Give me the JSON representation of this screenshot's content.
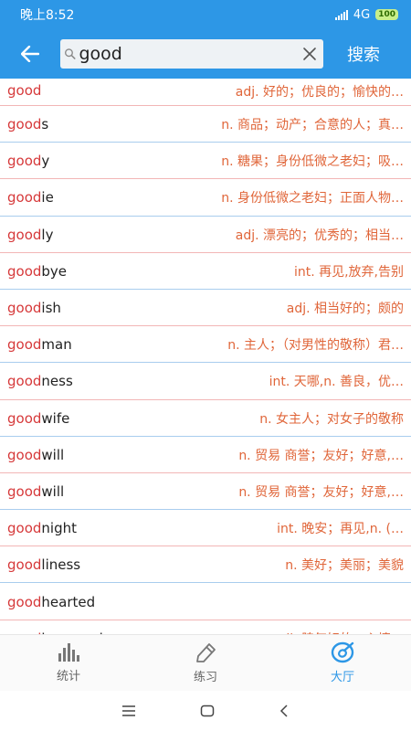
{
  "status_bar": {
    "time": "晚上8:52",
    "network": "4G",
    "battery": "100"
  },
  "search": {
    "query": "good",
    "submit_label": "搜索"
  },
  "colors": {
    "primary": "#2d97e6",
    "highlight": "#d6393a",
    "definition": "#e0663a"
  },
  "results": [
    {
      "prefix": "good",
      "rest": "",
      "definition": "adj. 好的；优良的；愉快的…",
      "line": "red"
    },
    {
      "prefix": "good",
      "rest": "s",
      "definition": "n. 商品；动产；合意的人；真…",
      "line": "blue"
    },
    {
      "prefix": "good",
      "rest": "y",
      "definition": "n. 糖果；身份低微之老妇；吸…",
      "line": "red"
    },
    {
      "prefix": "good",
      "rest": "ie",
      "definition": "n. 身份低微之老妇；正面人物…",
      "line": "blue"
    },
    {
      "prefix": "good",
      "rest": "ly",
      "definition": "adj. 漂亮的；优秀的；相当…",
      "line": "red"
    },
    {
      "prefix": "good",
      "rest": "bye",
      "definition": "int. 再见,放弃,告别",
      "line": "blue"
    },
    {
      "prefix": "good",
      "rest": "ish",
      "definition": "adj. 相当好的；颇的",
      "line": "red"
    },
    {
      "prefix": "good",
      "rest": "man",
      "definition": "n. 主人；（对男性的敬称）君…",
      "line": "blue"
    },
    {
      "prefix": "good",
      "rest": "ness",
      "definition": "int. 天哪,n. 善良，优…",
      "line": "red"
    },
    {
      "prefix": "good",
      "rest": "wife",
      "definition": "n. 女主人；对女子的敬称",
      "line": "blue"
    },
    {
      "prefix": "good",
      "rest": "will",
      "definition": "n. 贸易 商誉；友好；好意,…",
      "line": "red"
    },
    {
      "prefix": "good",
      "rest": "will",
      "definition": "n. 贸易 商誉；友好；好意,…",
      "line": "blue"
    },
    {
      "prefix": "good",
      "rest": "night",
      "definition": "int. 晚安；再见,n. (…",
      "line": "red"
    },
    {
      "prefix": "good",
      "rest": "liness",
      "definition": "n. 美好；美丽；美貌",
      "line": "blue"
    },
    {
      "prefix": "good",
      "rest": "hearted",
      "definition": "",
      "line": "red"
    },
    {
      "prefix": "good",
      "rest": "humored",
      "definition": "adj. 脾气好的；心情…",
      "line": "blue"
    }
  ],
  "bottom_nav": [
    {
      "label": "统计",
      "icon": "bar-chart-icon",
      "active": false
    },
    {
      "label": "练习",
      "icon": "pencil-icon",
      "active": false
    },
    {
      "label": "大厅",
      "icon": "hall-icon",
      "active": true
    }
  ]
}
